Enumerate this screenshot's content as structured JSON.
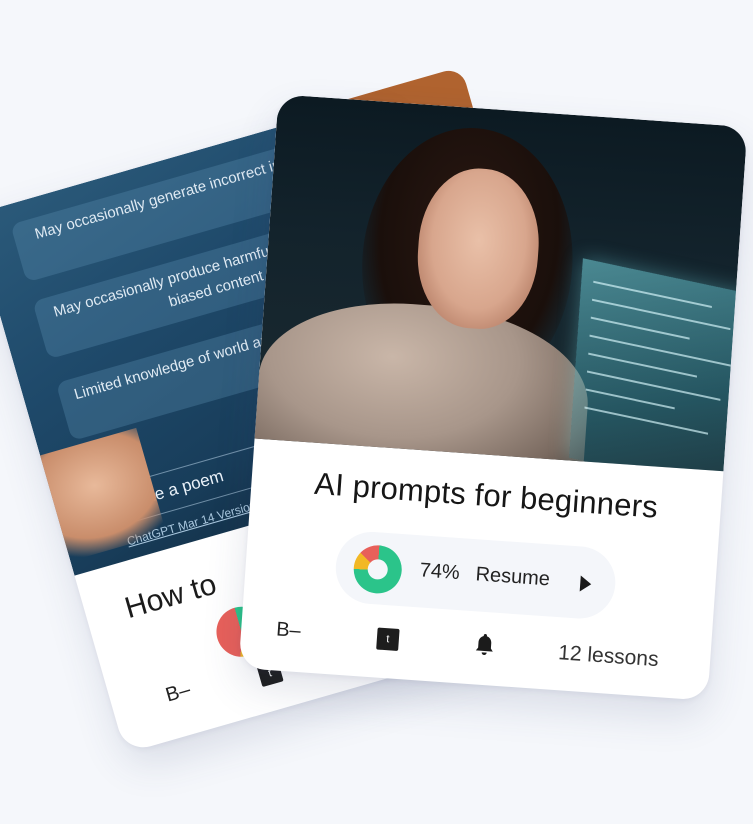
{
  "back_card": {
    "image_text": {
      "row1": "May occasionally generate incorrect information",
      "row2": "May occasionally produce harmful instructions or biased content",
      "row3": "Limited knowledge of world and events after 2021",
      "input_value": "write a poem",
      "caption": "ChatGPT Mar 14 Version"
    },
    "title": "How to",
    "badge_letter": "B–",
    "t_icon_label": "t"
  },
  "front_card": {
    "title": "AI prompts for beginners",
    "progress": {
      "percent_value": 74,
      "percent_label": "74%",
      "action_label": "Resume"
    },
    "badge_letter": "B–",
    "t_icon_label": "t",
    "lessons_label": "12 lessons"
  },
  "colors": {
    "accent_green": "#2bc48a",
    "accent_yellow": "#f2b825",
    "accent_red": "#e8605a",
    "back_accent": "#b0632f"
  },
  "icons": [
    "play-icon",
    "bell-icon",
    "t-icon",
    "donut-chart-icon"
  ]
}
